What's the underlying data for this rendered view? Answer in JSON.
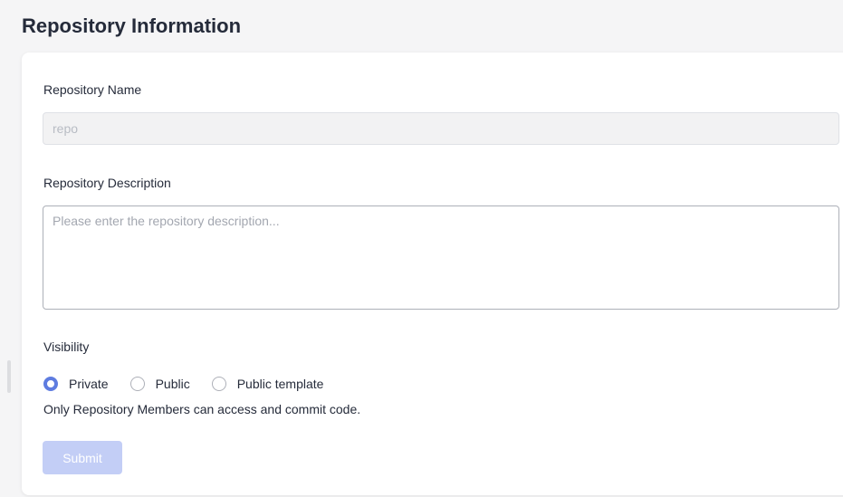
{
  "page": {
    "title": "Repository Information"
  },
  "form": {
    "name_label": "Repository Name",
    "name_value": "repo",
    "description_label": "Repository Description",
    "description_placeholder": "Please enter the repository description...",
    "visibility_label": "Visibility",
    "visibility_options": [
      {
        "label": "Private",
        "selected": true
      },
      {
        "label": "Public",
        "selected": false
      },
      {
        "label": "Public template",
        "selected": false
      }
    ],
    "visibility_hint": "Only Repository Members can access and commit code.",
    "submit_label": "Submit"
  },
  "colors": {
    "accent": "#5e7ce0",
    "submit_disabled_bg": "#c3cef6"
  }
}
